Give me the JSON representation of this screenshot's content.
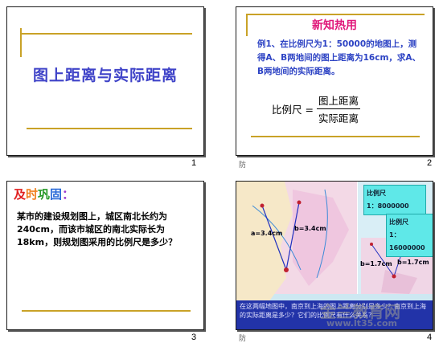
{
  "slides": [
    {
      "number": "1",
      "title": "图上距离与实际距离"
    },
    {
      "number": "2",
      "title": "新知热用",
      "body": "例1、在比例尺为1：50000的地图上，测得A、B两地间的图上距离为16cm，求A、B两地间的实际距离。",
      "formula": {
        "lhs": "比例尺 =",
        "numerator": "图上距离",
        "denominator": "实际距离"
      },
      "handout_mark": "防"
    },
    {
      "number": "3",
      "title_chars": [
        "及",
        "时",
        "巩",
        "固",
        "："
      ],
      "title_colors": [
        "#e02020",
        "#f08020",
        "#2a9a2a",
        "#2a6ad8",
        "#9a3ad0"
      ],
      "body": "某市的建设规划图上，城区南北长约为240cm，而该市城区的南北实际长为18km，则规划图采用的比例尺是多少？"
    },
    {
      "number": "4",
      "legend1": {
        "label": "比例尺",
        "value": "1：8000000"
      },
      "legend2": {
        "label": "比例尺",
        "value": "1：16000000"
      },
      "map_labels": [
        "a=3.4cm",
        "b=3.4cm",
        "b=1.7cm",
        "b=1.7cm"
      ],
      "caption": "在这两幅地图中，南京到上海的图上距离分别是多少？南京到上海的实际距离是多少？它们的比例尺有什么关系？",
      "handout_mark": "防",
      "watermark_cn": "金兰教育网",
      "watermark_url": "www.lt35.com"
    }
  ],
  "colors": {
    "gold": "#c9a227",
    "title_blue": "#3f43c8",
    "pink": "#e0187a",
    "body_blue": "#2d43c4"
  }
}
